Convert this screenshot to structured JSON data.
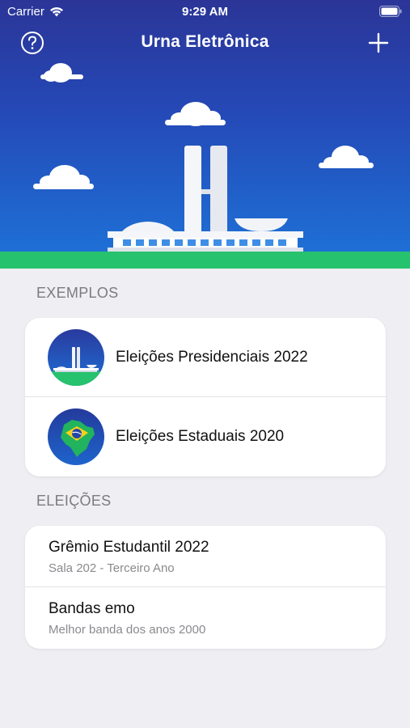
{
  "status_bar": {
    "carrier": "Carrier",
    "time": "9:29 AM"
  },
  "navbar": {
    "title": "Urna Eletrônica",
    "help_icon": "question-circle-icon",
    "add_icon": "plus-icon"
  },
  "colors": {
    "sky_top": "#2b3597",
    "sky_bottom": "#1d74d9",
    "grass": "#27c26e",
    "background": "#eeeef3"
  },
  "examples": {
    "header": "EXEMPLOS",
    "items": [
      {
        "label": "Eleições Presidenciais 2022",
        "icon": "congress-icon"
      },
      {
        "label": "Eleições Estaduais 2020",
        "icon": "brazil-map-icon"
      }
    ]
  },
  "elections": {
    "header": "ELEIÇÕES",
    "items": [
      {
        "title": "Grêmio Estudantil 2022",
        "subtitle": "Sala 202 - Terceiro Ano"
      },
      {
        "title": "Bandas emo",
        "subtitle": "Melhor banda dos anos 2000"
      }
    ]
  }
}
